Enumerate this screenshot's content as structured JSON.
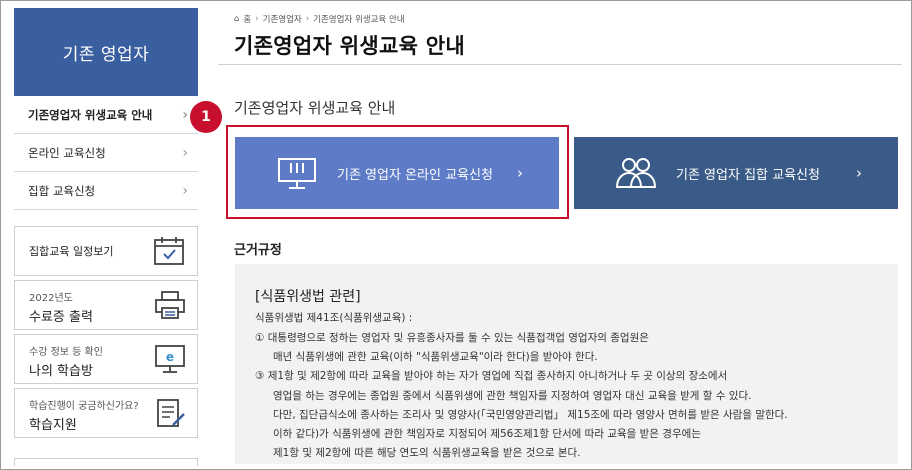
{
  "sidebar": {
    "title": "기존 영업자",
    "menu": [
      {
        "label": "기존영업자 위생교육 안내",
        "active": true
      },
      {
        "label": "온라인 교육신청",
        "active": false
      },
      {
        "label": "집합 교육신청",
        "active": false
      }
    ],
    "quick_links": [
      {
        "small": "",
        "large": "",
        "only": "집합교육 일정보기",
        "icon": "calendar-check-icon"
      },
      {
        "small": "2022년도",
        "large": "수료증 출력",
        "only": "",
        "icon": "printer-icon"
      },
      {
        "small": "수강 정보 등 확인",
        "large": "나의 학습방",
        "only": "",
        "icon": "monitor-e-icon"
      },
      {
        "small": "학습진행이 궁금하신가요?",
        "large": "학습지원",
        "only": "",
        "icon": "document-pencil-icon"
      }
    ]
  },
  "breadcrumb": {
    "home": "홈",
    "items": [
      "기존영업자",
      "기존영업자 위생교육 안내"
    ]
  },
  "page": {
    "title": "기존영업자 위생교육 안내",
    "subtitle": "기존영업자 위생교육 안내",
    "annotation_number": "1"
  },
  "buttons": {
    "online": {
      "label": "기존 영업자 온라인 교육신청",
      "chevron": "›",
      "icon": "online-monitor-icon"
    },
    "group": {
      "label": "기존 영업자 집합 교육신청",
      "chevron": "›",
      "icon": "group-people-icon"
    }
  },
  "basis": {
    "heading": "근거규정",
    "law_title": "[식품위생법 관련]",
    "lines": [
      "식품위생법 제41조(식품위생교육) :",
      "① 대통령령으로 정하는 영업자 및 유흥종사자를 둘 수 있는 식품접객업 영업자의 종업원은",
      "매년 식품위생에 관한 교육(이하 \"식품위생교육\"이라 한다)을 받아야 한다.",
      "③ 제1항 및 제2항에 따라 교육을 받아야 하는 자가 영업에 직접 종사하지 아니하거나 두 곳 이상의 장소에서",
      "영업을 하는 경우에는 종업원 중에서 식품위생에 관한 책임자를 지정하여 영업자 대신 교육을 받게 할 수 있다.",
      "다만, 집단급식소에 종사하는 조리사 및 영양사(「국민영양관리법」 제15조에 따라 영양사 면허를 받은 사람을 말한다.",
      "이하 같다)가 식품위생에 관한 책임자로 지정되어 제56조제1항 단서에 따라 교육을 받은 경우에는",
      "제1항 및 제2항에 따른 해당 연도의 식품위생교육을 받은 것으로 본다."
    ]
  },
  "colors": {
    "sidebar_header": "#3a5fa0",
    "online_button": "#5d7bc6",
    "group_button": "#3a5a87",
    "annotation_red": "#c8102e"
  }
}
